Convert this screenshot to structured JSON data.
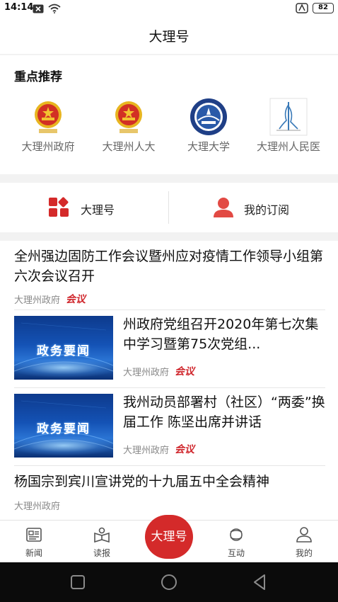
{
  "status_bar": {
    "time": "14:14",
    "battery": "82",
    "icons": [
      "notification-x-icon",
      "wifi-icon",
      "nfc-icon",
      "battery-icon"
    ]
  },
  "header": {
    "title": "大理号"
  },
  "recommend": {
    "title": "重点推荐",
    "items": [
      {
        "label": "大理州政府",
        "icon": "national-emblem-logo"
      },
      {
        "label": "大理州人大",
        "icon": "national-emblem-logo"
      },
      {
        "label": "大理大学",
        "icon": "university-seal-logo"
      },
      {
        "label": "大理州人民医",
        "icon": "hospital-logo"
      }
    ]
  },
  "tabs": {
    "dali_hao": "大理号",
    "my_subscription": "我的订阅"
  },
  "news": [
    {
      "title": "全州强边固防工作会议暨州应对疫情工作领导小组第六次会议召开",
      "source": "大理州政府",
      "tag": "会议"
    },
    {
      "title": "州政府党组召开2020年第七次集中学习暨第75次党组...",
      "source": "大理州政府",
      "tag": "会议",
      "thumb_text": "政务要闻"
    },
    {
      "title": "我州动员部署村（社区）“两委”换届工作 陈坚出席并讲话",
      "source": "大理州政府",
      "tag": "会议",
      "thumb_text": "政务要闻"
    },
    {
      "title": "杨国宗到宾川宣讲党的十九届五中全会精神",
      "source": "大理州政府"
    }
  ],
  "bottom_nav": {
    "items": [
      {
        "label": "新闻",
        "icon": "newspaper-icon"
      },
      {
        "label": "读报",
        "icon": "reader-icon"
      },
      {
        "label": "互动",
        "icon": "interaction-icon"
      },
      {
        "label": "我的",
        "icon": "user-icon"
      }
    ],
    "center_label": "大理号"
  },
  "colors": {
    "accent": "#d42a2a",
    "tag": "#d0282e",
    "page_bg": "#f2f2f2"
  }
}
